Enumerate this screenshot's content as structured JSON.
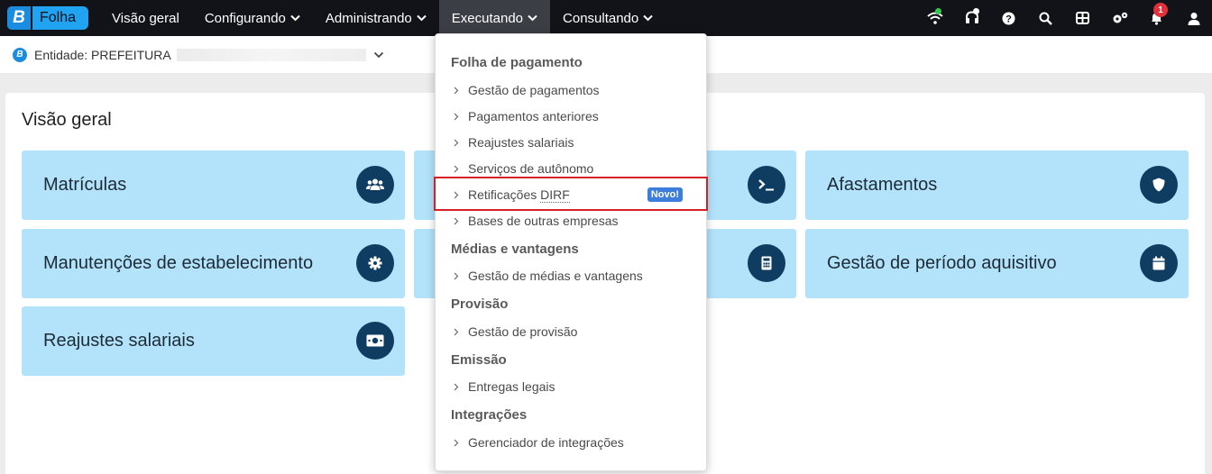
{
  "brand": {
    "logo_letter": "B",
    "name": "Folha"
  },
  "nav": {
    "items": [
      {
        "label": "Visão geral",
        "has_chevron": false
      },
      {
        "label": "Configurando",
        "has_chevron": true
      },
      {
        "label": "Administrando",
        "has_chevron": true
      },
      {
        "label": "Executando",
        "has_chevron": true,
        "active": true
      },
      {
        "label": "Consultando",
        "has_chevron": true
      }
    ]
  },
  "header_icons": {
    "items": [
      "wifi-icon",
      "headset-icon",
      "help-icon",
      "search-icon",
      "apps-grid-icon",
      "settings-icon",
      "bell-icon",
      "user-icon"
    ],
    "notification_count": "1",
    "status_color": "#35c84f"
  },
  "entity": {
    "logo_letter": "B",
    "label": "Entidade: PREFEITURA"
  },
  "overview": {
    "title": "Visão geral",
    "tiles": [
      {
        "label": "Matrículas",
        "icon": "users-icon"
      },
      {
        "label": "",
        "icon": "terminal-icon"
      },
      {
        "label": "Afastamentos",
        "icon": "shield-icon"
      },
      {
        "label": "Manutenções de estabelecimento",
        "icon": "gear-icon"
      },
      {
        "label": "",
        "icon": "calculator-icon"
      },
      {
        "label": "Gestão de período aquisitivo",
        "icon": "calendar-icon"
      },
      {
        "label": "Reajustes salariais",
        "icon": "money-icon"
      }
    ]
  },
  "dropdown": {
    "sections": [
      {
        "title": "Folha de pagamento",
        "items": [
          "Gestão de pagamentos",
          "Pagamentos anteriores",
          "Reajustes salariais",
          "Serviços de autônomo",
          "Retificações DIRF",
          "Bases de outras empresas"
        ]
      },
      {
        "title": "Médias e vantagens",
        "items": [
          "Gestão de médias e vantagens"
        ]
      },
      {
        "title": "Provisão",
        "items": [
          "Gestão de provisão"
        ]
      },
      {
        "title": "Emissão",
        "items": [
          "Entregas legais"
        ]
      },
      {
        "title": "Integrações",
        "items": [
          "Gerenciador de integrações"
        ]
      }
    ],
    "highlight": {
      "item": "Retificações DIRF",
      "badge": "Novo!"
    },
    "retificacoes_prefix": "Retificações ",
    "retificacoes_suffix": "DIRF"
  }
}
